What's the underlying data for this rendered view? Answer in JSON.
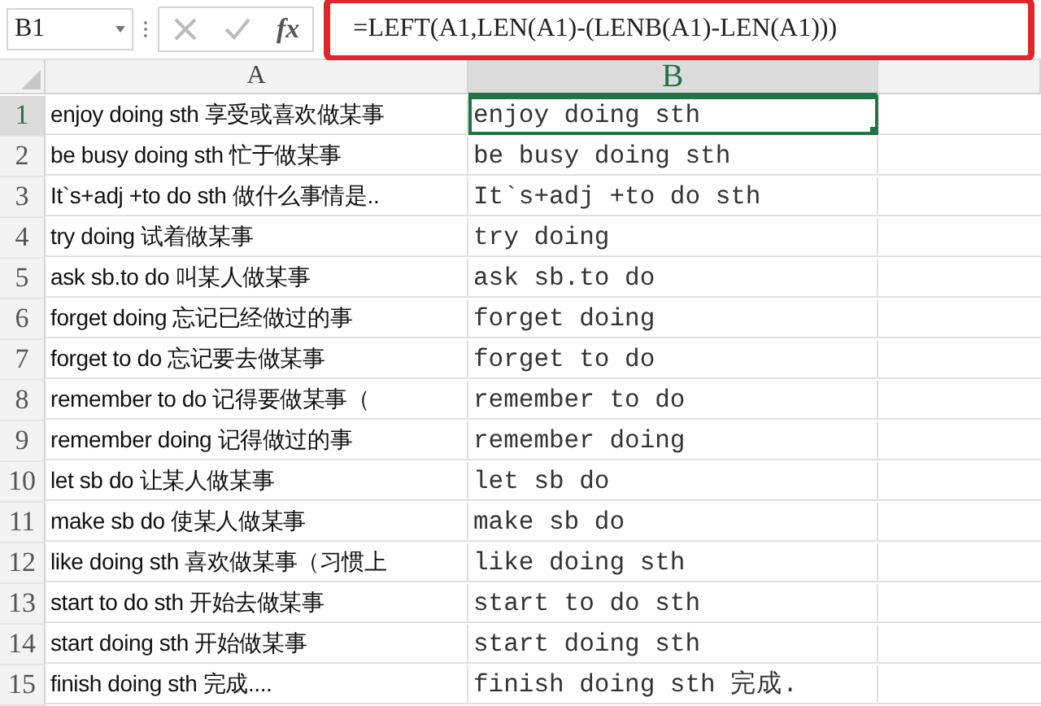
{
  "name_box": {
    "value": "B1"
  },
  "formula_bar": {
    "fx_label": "fx",
    "formula": "=LEFT(A1,LEN(A1)-(LENB(A1)-LEN(A1)))",
    "highlighted": true
  },
  "columns": [
    {
      "label": "A",
      "selected": false
    },
    {
      "label": "B",
      "selected": true
    }
  ],
  "rows": [
    {
      "number": "1",
      "a": "enjoy doing sth 享受或喜欢做某事",
      "b": "enjoy doing sth",
      "selected": true
    },
    {
      "number": "2",
      "a": "be busy doing sth 忙于做某事",
      "b": "be busy doing sth",
      "selected": false
    },
    {
      "number": "3",
      "a": "It`s+adj +to do sth 做什么事情是..",
      "b": "It`s+adj +to do sth",
      "selected": false
    },
    {
      "number": "4",
      "a": "try doing 试着做某事",
      "b": "try doing",
      "selected": false
    },
    {
      "number": "5",
      "a": "ask sb.to do 叫某人做某事",
      "b": "ask sb.to do",
      "selected": false
    },
    {
      "number": "6",
      "a": "forget doing 忘记已经做过的事",
      "b": "forget doing",
      "selected": false
    },
    {
      "number": "7",
      "a": "forget to do 忘记要去做某事",
      "b": "forget to do",
      "selected": false
    },
    {
      "number": "8",
      "a": "remember to do 记得要做某事（",
      "b": "remember to do",
      "selected": false
    },
    {
      "number": "9",
      "a": "remember doing 记得做过的事",
      "b": "remember doing",
      "selected": false
    },
    {
      "number": "10",
      "a": "let sb do 让某人做某事",
      "b": "let sb do",
      "selected": false
    },
    {
      "number": "11",
      "a": "make sb do 使某人做某事",
      "b": "make sb do",
      "selected": false
    },
    {
      "number": "12",
      "a": "like doing sth 喜欢做某事（习惯上",
      "b": "like doing sth",
      "selected": false
    },
    {
      "number": "13",
      "a": "start to do sth 开始去做某事",
      "b": "start to do sth",
      "selected": false
    },
    {
      "number": "14",
      "a": "start doing sth 开始做某事",
      "b": "start doing sth",
      "selected": false
    },
    {
      "number": "15",
      "a": "finish doing sth 完成....",
      "b": "finish doing sth 完成.",
      "selected": false
    }
  ]
}
